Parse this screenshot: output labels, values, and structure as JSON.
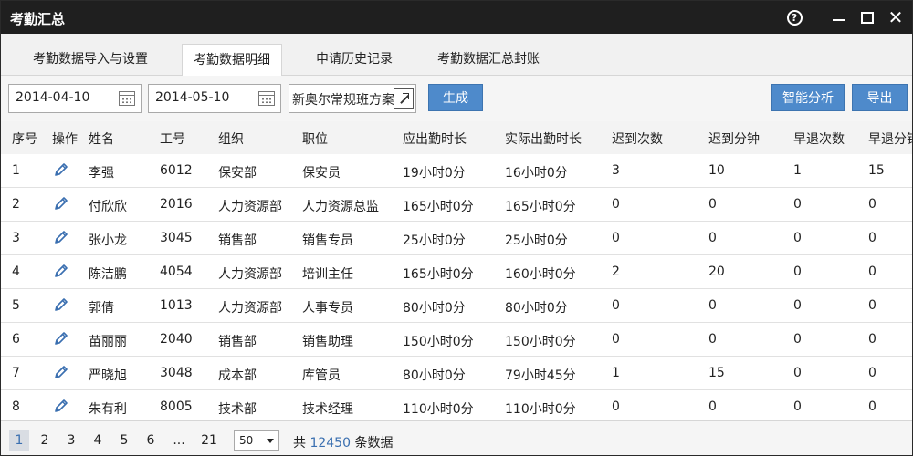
{
  "window": {
    "title": "考勤汇总"
  },
  "tabs": [
    {
      "label": "考勤数据导入与设置"
    },
    {
      "label": "考勤数据明细"
    },
    {
      "label": "申请历史记录"
    },
    {
      "label": "考勤数据汇总封账"
    }
  ],
  "toolbar": {
    "start_date": "2014-04-10",
    "end_date": "2014-05-10",
    "plan": "新奥尔常规班方案",
    "generate_label": "生成",
    "analyze_label": "智能分析",
    "export_label": "导出"
  },
  "columns": [
    "序号",
    "操作",
    "姓名",
    "工号",
    "组织",
    "职位",
    "应出勤时长",
    "实际出勤时长",
    "迟到次数",
    "迟到分钟",
    "早退次数",
    "早退分钟"
  ],
  "rows": [
    {
      "no": "1",
      "name": "李强",
      "id": "6012",
      "org": "保安部",
      "pos": "保安员",
      "due": "19小时0分",
      "actual": "16小时0分",
      "late_count": "3",
      "late_min": "10",
      "early_count": "1",
      "early_min": "15"
    },
    {
      "no": "2",
      "name": "付欣欣",
      "id": "2016",
      "org": "人力资源部",
      "pos": "人力资源总监",
      "due": "165小时0分",
      "actual": "165小时0分",
      "late_count": "0",
      "late_min": "0",
      "early_count": "0",
      "early_min": "0"
    },
    {
      "no": "3",
      "name": "张小龙",
      "id": "3045",
      "org": "销售部",
      "pos": "销售专员",
      "due": "25小时0分",
      "actual": "25小时0分",
      "late_count": "0",
      "late_min": "0",
      "early_count": "0",
      "early_min": "0"
    },
    {
      "no": "4",
      "name": "陈洁鹏",
      "id": "4054",
      "org": "人力资源部",
      "pos": "培训主任",
      "due": "165小时0分",
      "actual": "160小时0分",
      "late_count": "2",
      "late_min": "20",
      "early_count": "0",
      "early_min": "0"
    },
    {
      "no": "5",
      "name": "郭倩",
      "id": "1013",
      "org": "人力资源部",
      "pos": "人事专员",
      "due": "80小时0分",
      "actual": "80小时0分",
      "late_count": "0",
      "late_min": "0",
      "early_count": "0",
      "early_min": "0"
    },
    {
      "no": "6",
      "name": "苗丽丽",
      "id": "2040",
      "org": "销售部",
      "pos": "销售助理",
      "due": "150小时0分",
      "actual": "150小时0分",
      "late_count": "0",
      "late_min": "0",
      "early_count": "0",
      "early_min": "0"
    },
    {
      "no": "7",
      "name": "严晓旭",
      "id": "3048",
      "org": "成本部",
      "pos": "库管员",
      "due": "80小时0分",
      "actual": "79小时45分",
      "late_count": "1",
      "late_min": "15",
      "early_count": "0",
      "early_min": "0"
    },
    {
      "no": "8",
      "name": "朱有利",
      "id": "8005",
      "org": "技术部",
      "pos": "技术经理",
      "due": "110小时0分",
      "actual": "110小时0分",
      "late_count": "0",
      "late_min": "0",
      "early_count": "0",
      "early_min": "0"
    }
  ],
  "pagination": {
    "pages": [
      "1",
      "2",
      "3",
      "4",
      "5",
      "6",
      "...",
      "21"
    ],
    "page_size": "50",
    "total_prefix": "共",
    "total_count": "12450",
    "total_suffix": "条数据"
  },
  "colors": {
    "accent": "#4e8acb",
    "titlebar": "#1f1f1f",
    "link": "#3a6fb0"
  },
  "icons": {
    "help": "help-circle-icon",
    "edit": "pencil-icon",
    "calendar": "calendar-icon",
    "external": "external-link-icon"
  }
}
